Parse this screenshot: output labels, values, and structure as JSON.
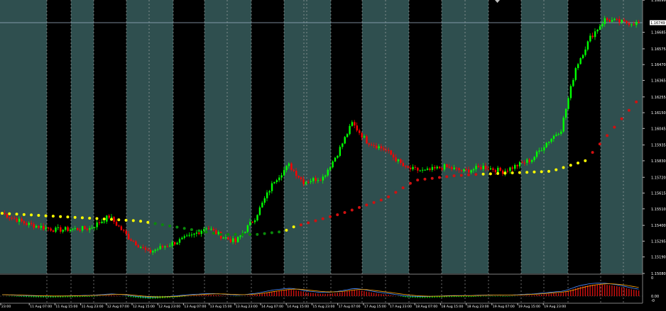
{
  "colors": {
    "background": "#000000",
    "session_band": "#2f4f4f",
    "bull_candle": "#00ff00",
    "bear_candle": "#ff0000",
    "ma_yellow": "#ffff00",
    "ma_red": "#d01010",
    "ma_green": "#0a8a0a",
    "grid": "#c0c0c0",
    "axis_text": "#ffffff",
    "current_price_bg": "#ffffff",
    "current_price_fg": "#000000",
    "macd_signal": "#ffa500",
    "macd_main": "#4a8cff"
  },
  "price_axis": {
    "labels": [
      "1.16899",
      "1.16685",
      "1.16575",
      "1.16470",
      "1.16365",
      "1.16255",
      "1.16150",
      "1.16045",
      "1.15935",
      "1.15830",
      "1.15720",
      "1.15615",
      "1.15510",
      "1.15400",
      "1.15295",
      "1.15190",
      "1.15080"
    ],
    "current_price": "1.16749"
  },
  "indicator_axis": {
    "labels": [
      "0",
      "0.00",
      "-0"
    ]
  },
  "time_axis": {
    "labels": [
      "23:00",
      "11 Aug 07:00",
      "11 Aug 15:00",
      "11 Aug 23:00",
      "12 Aug 07:00",
      "12 Aug 15:00",
      "12 Aug 23:00",
      "13 Aug 07:00",
      "13 Aug 15:00",
      "13 Aug 23:00",
      "14 Aug 07:00",
      "14 Aug 15:00",
      "15 Aug 23:00",
      "17 Aug 07:00",
      "17 Aug 15:00",
      "17 Aug 23:00",
      "18 Aug 07:00",
      "18 Aug 15:00",
      "18 Aug 23:00",
      "19 Aug 07:00",
      "19 Aug 15:00",
      "19 Aug 23:00"
    ]
  },
  "chart_data": {
    "type": "candlestick",
    "ylim": [
      1.1508,
      1.169
    ],
    "anchors": [
      [
        0,
        1.1548
      ],
      [
        10,
        1.1541
      ],
      [
        22,
        1.1537
      ],
      [
        36,
        1.1538
      ],
      [
        44,
        1.1546
      ],
      [
        52,
        1.1532
      ],
      [
        60,
        1.1522
      ],
      [
        70,
        1.1528
      ],
      [
        78,
        1.1533
      ],
      [
        84,
        1.1539
      ],
      [
        90,
        1.1533
      ],
      [
        96,
        1.1529
      ],
      [
        104,
        1.1545
      ],
      [
        112,
        1.157
      ],
      [
        118,
        1.158
      ],
      [
        124,
        1.1569
      ],
      [
        132,
        1.1572
      ],
      [
        138,
        1.1588
      ],
      [
        144,
        1.1608
      ],
      [
        150,
        1.1596
      ],
      [
        158,
        1.159
      ],
      [
        166,
        1.1578
      ],
      [
        174,
        1.1576
      ],
      [
        182,
        1.1579
      ],
      [
        190,
        1.1576
      ],
      [
        198,
        1.1579
      ],
      [
        206,
        1.1576
      ],
      [
        212,
        1.158
      ],
      [
        218,
        1.1584
      ],
      [
        224,
        1.1595
      ],
      [
        230,
        1.1604
      ],
      [
        236,
        1.1645
      ],
      [
        242,
        1.1665
      ],
      [
        248,
        1.1677
      ],
      [
        256,
        1.1675
      ],
      [
        262,
        1.16745
      ]
    ],
    "ma_points": [
      [
        0,
        1.1548,
        "yellow"
      ],
      [
        56,
        1.1543,
        "yellow"
      ],
      [
        60,
        1.1542,
        "green"
      ],
      [
        90,
        1.1534,
        "green"
      ],
      [
        105,
        1.1534,
        "green"
      ],
      [
        116,
        1.1536,
        "yellow"
      ],
      [
        120,
        1.1539,
        "red"
      ],
      [
        140,
        1.1548,
        "red"
      ],
      [
        158,
        1.1558,
        "red"
      ],
      [
        170,
        1.157,
        "red"
      ],
      [
        186,
        1.1573,
        "red"
      ],
      [
        196,
        1.1574,
        "yellow"
      ],
      [
        226,
        1.1576,
        "yellow"
      ],
      [
        240,
        1.1583,
        "red"
      ],
      [
        262,
        1.1624,
        "red"
      ]
    ]
  }
}
